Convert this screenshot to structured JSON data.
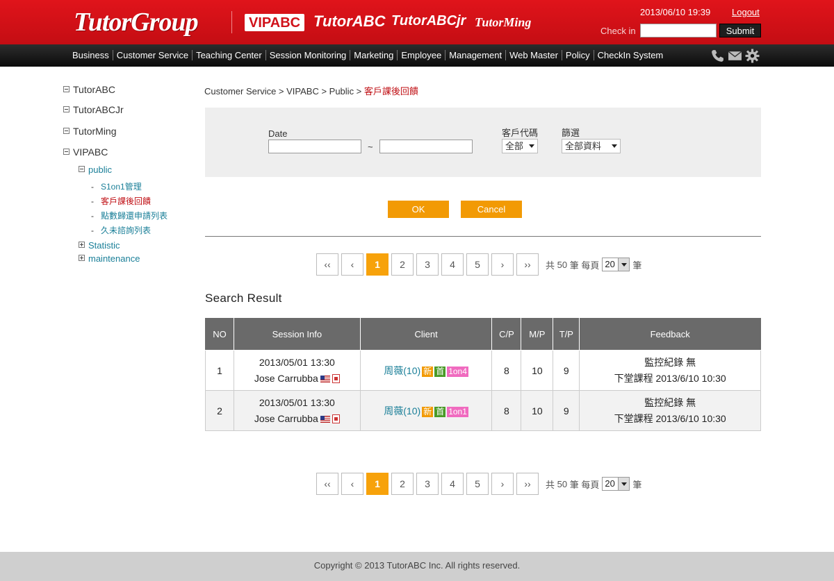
{
  "header": {
    "logo": "TutorGroup",
    "brands": [
      "VIPABC",
      "TutorABC",
      "TutorABCjr",
      "TutorMing"
    ],
    "datetime": "2013/06/10 19:39",
    "logout_label": "Logout",
    "checkin_label": "Check in",
    "checkin_value": "",
    "submit_label": "Submit"
  },
  "nav": {
    "items": [
      "Business",
      "Customer Service",
      "Teaching Center",
      "Session Monitoring",
      "Marketing",
      "Employee",
      "Management",
      "Web Master",
      "Policy",
      "CheckIn System"
    ],
    "icons": [
      "phone-icon",
      "mail-icon",
      "gear-icon"
    ]
  },
  "sidebar": {
    "roots": [
      "TutorABC",
      "TutorABCJr",
      "TutorMing",
      "VIPABC"
    ],
    "public_label": "public",
    "public_items": [
      "S1on1管理",
      "客戶課後回饋",
      "點數歸還申請列表",
      "久未諮詢列表"
    ],
    "statistic_label": "Statistic",
    "maintenance_label": "maintenance"
  },
  "breadcrumb": {
    "path": "Customer Service > VIPABC > Public > ",
    "current": "客戶課後回饋"
  },
  "filter": {
    "date_label": "Date",
    "date_from": "",
    "date_to": "",
    "tilde": "~",
    "client_code_label": "客戶代碼",
    "client_code_value": "全部",
    "filter_label": "篩選",
    "filter_value": "全部資料",
    "ok_label": "OK",
    "cancel_label": "Cancel"
  },
  "pager": {
    "first": "‹‹",
    "prev": "‹",
    "pages": [
      "1",
      "2",
      "3",
      "4",
      "5"
    ],
    "current_page": "1",
    "next": "›",
    "last": "››",
    "total_prefix": "共",
    "total": "50",
    "total_unit": "筆",
    "per_page_label": "每頁",
    "per_page": "20",
    "per_page_unit": "筆"
  },
  "results": {
    "title": "Search Result",
    "columns": [
      "NO",
      "Session Info",
      "Client",
      "C/P",
      "M/P",
      "T/P",
      "Feedback"
    ],
    "rows": [
      {
        "no": "1",
        "session_time": "2013/05/01 13:30",
        "consultant": "Jose Carrubba",
        "client_name": "周薇(10)",
        "tag_new": "新",
        "tag_first": "首",
        "tag_type": "1on4",
        "cp": "8",
        "mp": "10",
        "tp": "9",
        "fb_line1": "監控紀錄 無",
        "fb_line2": "下堂課程 2013/6/10 10:30"
      },
      {
        "no": "2",
        "session_time": "2013/05/01 13:30",
        "consultant": "Jose Carrubba",
        "client_name": "周薇(10)",
        "tag_new": "新",
        "tag_first": "首",
        "tag_type": "1on1",
        "cp": "8",
        "mp": "10",
        "tp": "9",
        "fb_line1": "監控紀錄 無",
        "fb_line2": "下堂課程 2013/6/10 10:30"
      }
    ]
  },
  "footer": {
    "copyright": "Copyright © 2013 TutorABC Inc. All rights reserved."
  },
  "colors": {
    "header_red": "#d0121a",
    "nav_black": "#111111",
    "accent_orange": "#f29a05",
    "link_teal": "#1a7f98",
    "active_red": "#c01116",
    "table_header": "#6a6a6a"
  }
}
